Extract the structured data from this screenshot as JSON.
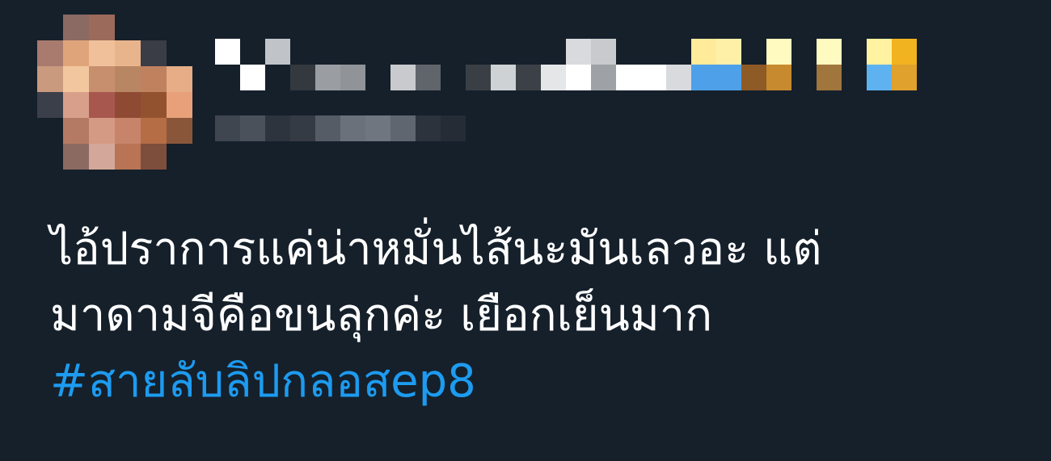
{
  "tweet": {
    "author": {
      "avatar_state": "pixelated",
      "name_state": "pixelated",
      "handle_state": "pixelated"
    },
    "text_lines": [
      "ไอ้ปราการแค่น่าหมั่นไส้นะมันเลวอะ แต่",
      "มาดามจีคือขนลุกค่ะ เยือกเย็นมาก"
    ],
    "hashtag": "#สายลับลิปกลอสep8",
    "colors": {
      "background": "#15202b",
      "text": "#ffffff",
      "link": "#1d9bf0"
    }
  }
}
